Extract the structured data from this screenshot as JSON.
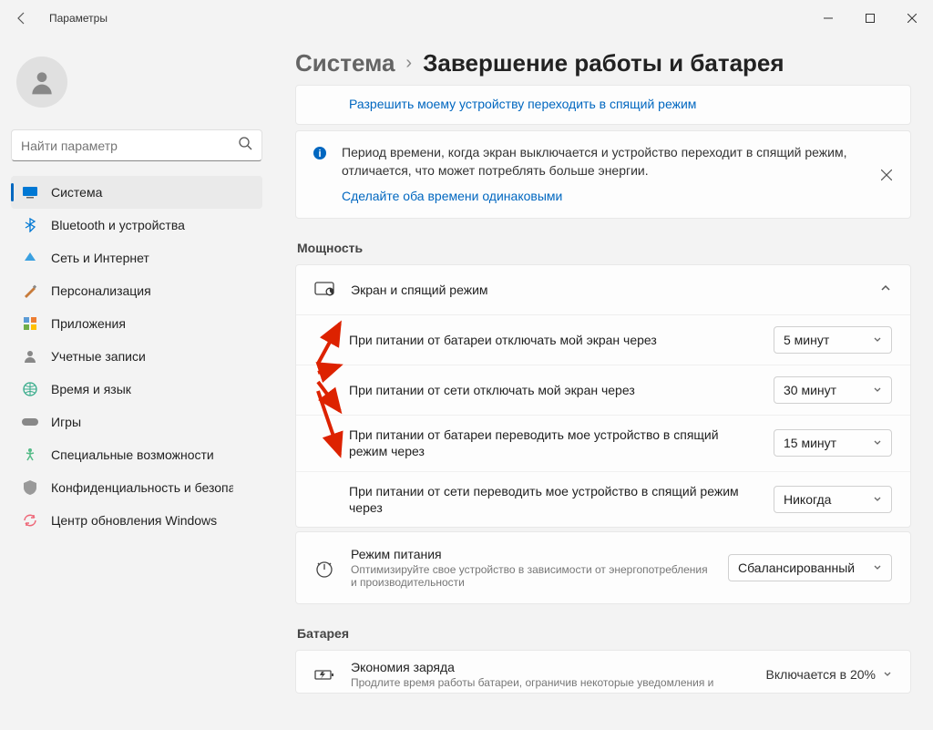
{
  "app_title": "Параметры",
  "search": {
    "placeholder": "Найти параметр"
  },
  "nav": [
    {
      "label": "Система"
    },
    {
      "label": "Bluetooth и устройства"
    },
    {
      "label": "Сеть и Интернет"
    },
    {
      "label": "Персонализация"
    },
    {
      "label": "Приложения"
    },
    {
      "label": "Учетные записи"
    },
    {
      "label": "Время и язык"
    },
    {
      "label": "Игры"
    },
    {
      "label": "Специальные возможности"
    },
    {
      "label": "Конфиденциальность и безопасность"
    },
    {
      "label": "Центр обновления Windows"
    }
  ],
  "breadcrumb": {
    "parent": "Система",
    "current": "Завершение работы и батарея"
  },
  "allow_sleep_link": "Разрешить моему устройству переходить в спящий режим",
  "info": {
    "text": "Период времени, когда экран выключается и устройство переходит в спящий режим, отличается, что может потреблять больше энергии.",
    "link": "Сделайте оба времени одинаковыми"
  },
  "section_power": "Мощность",
  "screen_card": {
    "title": "Экран и спящий режим"
  },
  "settings": [
    {
      "label": "При питании от батареи отключать мой экран через",
      "value": "5 минут"
    },
    {
      "label": "При питании от сети отключать мой экран через",
      "value": "30 минут"
    },
    {
      "label": "При питании от батареи переводить мое устройство в спящий режим через",
      "value": "15 минут"
    },
    {
      "label": "При питании от сети переводить мое устройство в спящий режим через",
      "value": "Никогда"
    }
  ],
  "power_mode": {
    "title": "Режим питания",
    "sub": "Оптимизируйте свое устройство в зависимости от энергопотребления и производительности",
    "value": "Сбалансированный"
  },
  "section_battery": "Батарея",
  "battery_saver": {
    "title": "Экономия заряда",
    "sub": "Продлите время работы батареи, ограничив некоторые уведомления и",
    "status": "Включается в 20%"
  }
}
